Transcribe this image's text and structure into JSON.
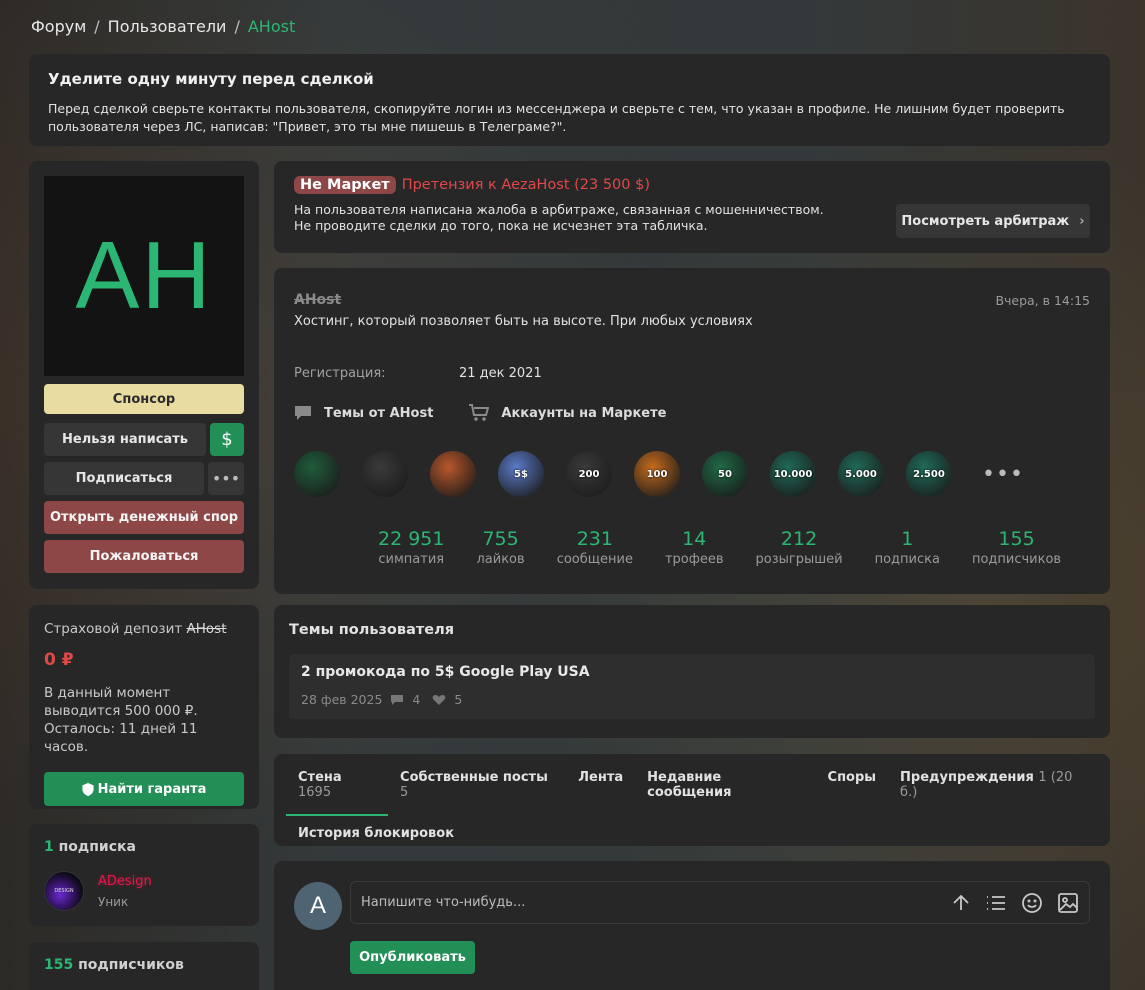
{
  "breadcrumb": {
    "forum": "Форум",
    "sep1": "/",
    "users": "Пользователи",
    "sep2": "/",
    "current": "AHost"
  },
  "notice": {
    "title": "Уделите одну минуту перед сделкой",
    "text": "Перед сделкой сверьте контакты пользователя, скопируйте логин из мессенджера и сверьте с тем, что указан в профиле. Не лишним будет проверить пользователя через ЛС, написав: \"Привет, это ты мне пишешь в Телеграме?\"."
  },
  "profile": {
    "avatar_text": "AH",
    "sponsor_label": "Спонсор",
    "cannot_write_label": "Нельзя написать",
    "dollar_glyph": "$",
    "subscribe_label": "Подписаться",
    "more_glyph": "•••",
    "dispute_label": "Открыть денежный спор",
    "report_label": "Пожаловаться"
  },
  "deposit": {
    "title": "Страховой депозит",
    "user": "AHost",
    "amount": "0 ₽",
    "desc": "В данный момент выводится 500 000 ₽. Осталось: 11 дней 11 часов.",
    "guarantor_label": "Найти гаранта"
  },
  "subscriptions": {
    "count": "1",
    "label": "подписка",
    "user_name": "ADesign",
    "user_role": "Уник",
    "avatar_text": "DESIGN"
  },
  "followers": {
    "count": "155",
    "label": "подписчиков"
  },
  "arbitration": {
    "badge": "Не Маркет",
    "claim": "Претензия к AezaHost (23 500 $)",
    "line1": "На пользователя написана жалоба в арбитраже, связанная с мошенничеством.",
    "line2": "Не проводите сделки до того, пока не исчезнет эта табличка.",
    "button_label": "Посмотреть арбитраж",
    "chevron": "›"
  },
  "info": {
    "name": "AHost",
    "time": "Вчера, в 14:15",
    "status": "Хостинг, который позволяет быть на высоте. При любых условиях",
    "reg_label": "Регистрация:",
    "reg_value": "21 дек 2021",
    "topics_link": "Темы от AHost",
    "market_link": "Аккаунты на Маркете",
    "trophies": [
      {
        "label": "",
        "color": "#1f5c3a"
      },
      {
        "label": "",
        "color": "#3a3a3a"
      },
      {
        "label": "",
        "color": "#b8572a"
      },
      {
        "label": "5$",
        "color": "#5a7ac8"
      },
      {
        "label": "200",
        "color": "#3a3a3a"
      },
      {
        "label": "100",
        "color": "#c46b1d"
      },
      {
        "label": "50",
        "color": "#1f6a46"
      },
      {
        "label": "10.000",
        "color": "#1f6a58"
      },
      {
        "label": "5.000",
        "color": "#1f6a58"
      },
      {
        "label": "2.500",
        "color": "#1f6a58"
      }
    ],
    "more_glyph": "•••",
    "stats": [
      {
        "n": "22 951",
        "label": "симпатия"
      },
      {
        "n": "755",
        "label": "лайков"
      },
      {
        "n": "231",
        "label": "сообщение"
      },
      {
        "n": "14",
        "label": "трофеев"
      },
      {
        "n": "212",
        "label": "розыгрышей"
      },
      {
        "n": "1",
        "label": "подписка"
      },
      {
        "n": "155",
        "label": "подписчиков"
      }
    ]
  },
  "topics": {
    "title": "Темы пользователя",
    "item_title": "2 промокода по 5$ Google Play USA",
    "item_date": "28 фев 2025",
    "item_comments": "4",
    "item_likes": "5"
  },
  "tabs": [
    {
      "label": "Стена",
      "count": "1695"
    },
    {
      "label": "Собственные посты",
      "count": "5"
    },
    {
      "label": "Лента",
      "count": ""
    },
    {
      "label": "Недавние сообщения",
      "count": ""
    },
    {
      "label": "Споры",
      "count": ""
    },
    {
      "label": "Предупреждения",
      "count": "1 (20 б.)"
    },
    {
      "label": "История блокировок",
      "count": ""
    }
  ],
  "compose": {
    "avatar_letter": "A",
    "placeholder": "Напишите что-нибудь...",
    "publish_label": "Опубликовать"
  }
}
